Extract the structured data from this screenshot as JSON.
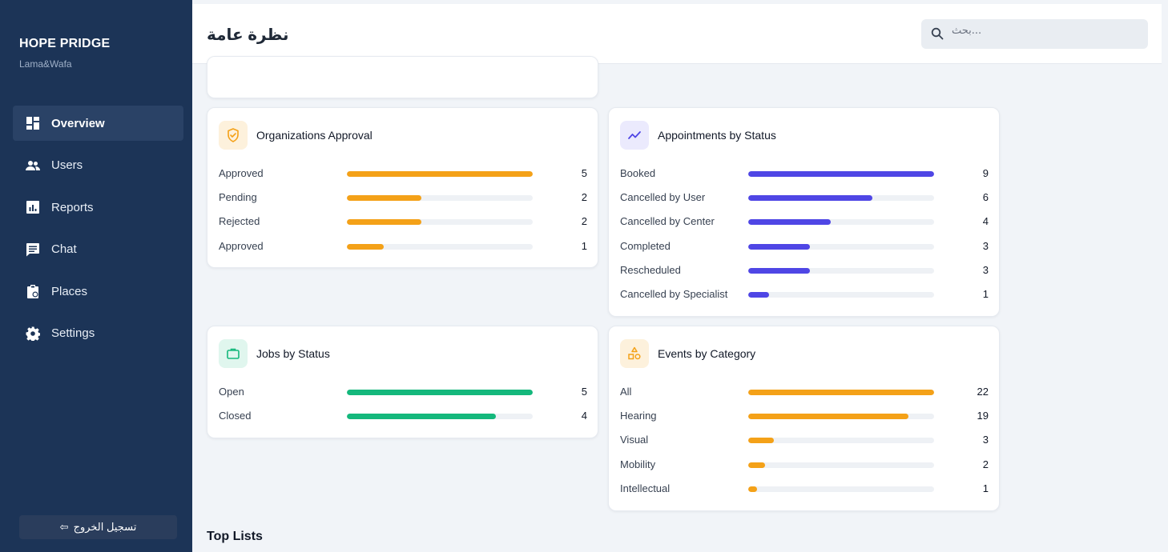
{
  "sidebar": {
    "brand": "HOPE PRIDGE",
    "subtitle": "Lama&Wafa",
    "items": [
      {
        "label": "Overview",
        "icon": "dashboard-icon",
        "active": true
      },
      {
        "label": "Users",
        "icon": "users-icon",
        "active": false
      },
      {
        "label": "Reports",
        "icon": "reports-icon",
        "active": false
      },
      {
        "label": "Chat",
        "icon": "chat-icon",
        "active": false
      },
      {
        "label": "Places",
        "icon": "places-icon",
        "active": false
      },
      {
        "label": "Settings",
        "icon": "gear-icon",
        "active": false
      }
    ],
    "logout_label": "تسجيل الخروج",
    "logout_icon": "logout-icon"
  },
  "header": {
    "title": "نظرة عامة",
    "search_placeholder": "...بحث"
  },
  "colors": {
    "sidebar_bg": "#1c3457",
    "orange": "#f4a118",
    "indigo": "#4f46e5",
    "green": "#14b87c"
  },
  "cards": {
    "org": {
      "title": "Organizations Approval",
      "icon": "shield-check-icon",
      "max": 5,
      "rows": [
        {
          "label": "Approved",
          "value": 5
        },
        {
          "label": "Pending",
          "value": 2
        },
        {
          "label": "Rejected",
          "value": 2
        },
        {
          "label": "Approved",
          "value": 1
        }
      ]
    },
    "appt": {
      "title": "Appointments by Status",
      "icon": "trend-line-icon",
      "max": 9,
      "rows": [
        {
          "label": "Booked",
          "value": 9
        },
        {
          "label": "Cancelled by User",
          "value": 6
        },
        {
          "label": "Cancelled by Center",
          "value": 4
        },
        {
          "label": "Completed",
          "value": 3
        },
        {
          "label": "Rescheduled",
          "value": 3
        },
        {
          "label": "Cancelled by Specialist",
          "value": 1
        }
      ]
    },
    "jobs": {
      "title": "Jobs by Status",
      "icon": "briefcase-icon",
      "max": 5,
      "rows": [
        {
          "label": "Open",
          "value": 5
        },
        {
          "label": "Closed",
          "value": 4
        }
      ]
    },
    "events": {
      "title": "Events by Category",
      "icon": "shapes-icon",
      "max": 22,
      "rows": [
        {
          "label": "All",
          "value": 22
        },
        {
          "label": "Hearing",
          "value": 19
        },
        {
          "label": "Visual",
          "value": 3
        },
        {
          "label": "Mobility",
          "value": 2
        },
        {
          "label": "Intellectual",
          "value": 1
        }
      ]
    }
  },
  "sections": {
    "top_lists": "Top Lists"
  }
}
